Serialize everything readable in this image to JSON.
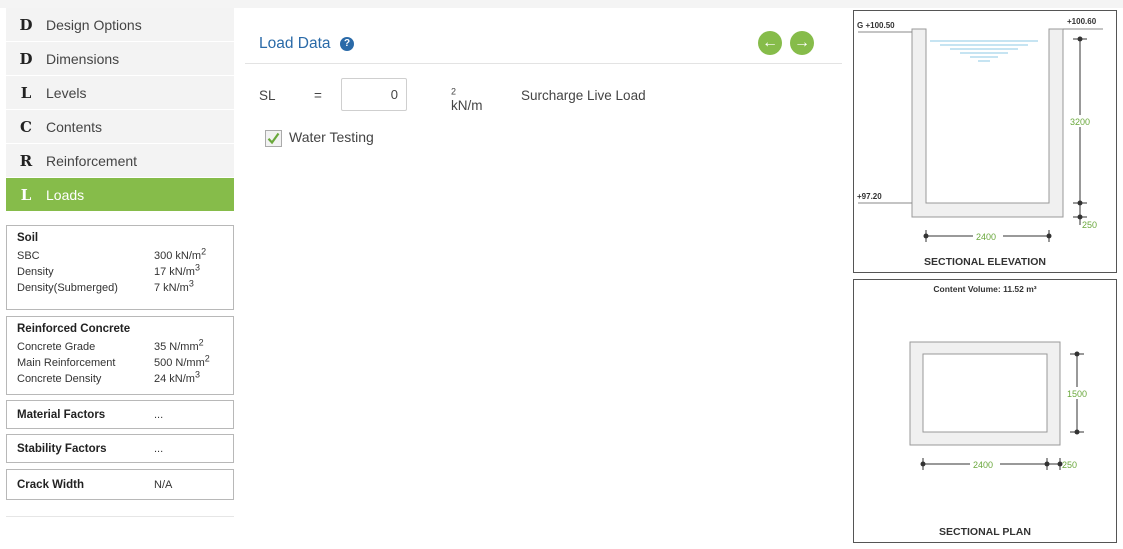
{
  "nav": [
    {
      "letter": "D",
      "label": "Design Options"
    },
    {
      "letter": "D",
      "label": "Dimensions"
    },
    {
      "letter": "L",
      "label": "Levels"
    },
    {
      "letter": "C",
      "label": "Contents"
    },
    {
      "letter": "R",
      "label": "Reinforcement"
    },
    {
      "letter": "L",
      "label": "Loads"
    }
  ],
  "soil": {
    "title": "Soil",
    "sbc": {
      "label": "SBC",
      "value": "300 kN/m",
      "sup": "2"
    },
    "density": {
      "label": "Density",
      "value": "17 kN/m",
      "sup": "3"
    },
    "density_sub": {
      "label": "Density(Submerged)",
      "value": "7 kN/m",
      "sup": "3"
    }
  },
  "rc": {
    "title": "Reinforced Concrete",
    "grade": {
      "label": "Concrete Grade",
      "value": "35 N/mm",
      "sup": "2"
    },
    "main": {
      "label": "Main Reinforcement",
      "value": "500 N/mm",
      "sup": "2"
    },
    "density": {
      "label": "Concrete Density",
      "value": "24 kN/m",
      "sup": "3"
    }
  },
  "material": {
    "label": "Material Factors",
    "value": "..."
  },
  "stability": {
    "label": "Stability Factors",
    "value": "..."
  },
  "crack": {
    "label": "Crack Width",
    "value": "N/A"
  },
  "main": {
    "title": "Load Data",
    "help": "?",
    "prev_icon": "arrow-left",
    "next_icon": "arrow-right",
    "sl": {
      "label": "SL",
      "eq": "=",
      "value": "0",
      "unit": "kN/m",
      "unit_sup": "2",
      "description": "Surcharge Live Load"
    },
    "water_testing": {
      "label": "Water Testing",
      "checked": true
    }
  },
  "elevation": {
    "g_level": "G +100.50",
    "top_level": "+100.60",
    "base_level": "+97.20",
    "height": "3200",
    "thickness": "250",
    "width": "2400",
    "caption": "SECTIONAL ELEVATION"
  },
  "plan": {
    "volume": "Content Volume: 11.52 m³",
    "depth": "1500",
    "width": "2400",
    "thickness": "250",
    "caption": "SECTIONAL PLAN"
  },
  "colors": {
    "accent": "#86bc4a",
    "title_blue": "#2a6aa8",
    "dim_green": "#6aa83c"
  }
}
